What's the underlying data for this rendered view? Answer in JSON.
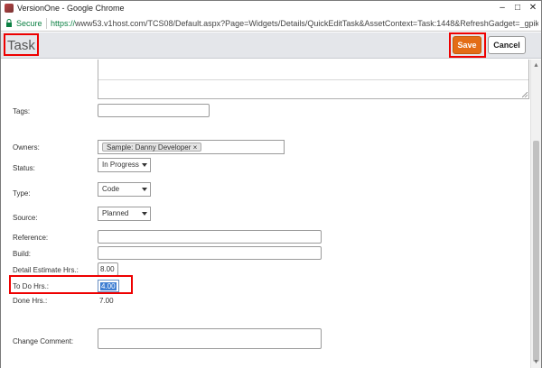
{
  "browser": {
    "window_title": "VersionOne - Google Chrome",
    "secure_label": "Secure",
    "url_protocol": "https://",
    "url_rest": "www53.v1host.com/TCS08/Default.aspx?Page=Widgets/Details/QuickEditTask&AssetContext=Task:1448&RefreshGadget=_gpikqym&Bub...",
    "minimize": "–",
    "maximize": "□",
    "close": "✕"
  },
  "header": {
    "title": "Task",
    "save_label": "Save",
    "cancel_label": "Cancel"
  },
  "form": {
    "tags_label": "Tags:",
    "tags_value": "",
    "owners_label": "Owners:",
    "owners_chip": "Sample: Danny Developer",
    "owners_chip_remove": "×",
    "status_label": "Status:",
    "status_value": "In Progress",
    "type_label": "Type:",
    "type_value": "Code",
    "source_label": "Source:",
    "source_value": "Planned",
    "reference_label": "Reference:",
    "reference_value": "",
    "build_label": "Build:",
    "build_value": "",
    "detail_estimate_label": "Detail Estimate Hrs.:",
    "detail_estimate_value": "8.00",
    "todo_label": "To Do Hrs.:",
    "todo_value": "4.00",
    "done_label": "Done Hrs.:",
    "done_value": "7.00",
    "comment_label": "Change Comment:",
    "comment_value": ""
  },
  "colors": {
    "save_button": "#e36c16",
    "highlight": "#ee0000",
    "header_bg": "#e4e6ea"
  },
  "icons": {
    "scroll_up": "▲",
    "scroll_down": "▼"
  }
}
